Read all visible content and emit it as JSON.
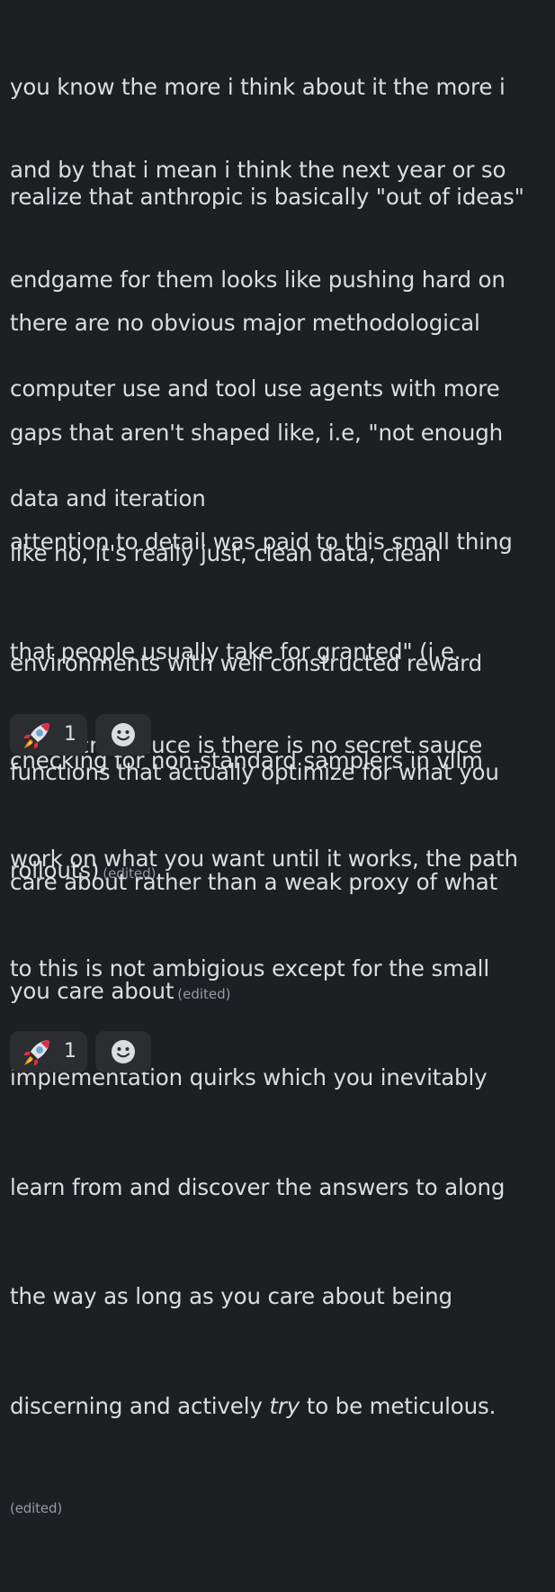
{
  "messages": [
    {
      "lines": [
        "you know the more i think about it the more i",
        "realize that anthropic is basically \"out of ideas\""
      ]
    },
    {
      "lines": [
        "and by that i mean i think the next year or so",
        "endgame for them looks like pushing hard on",
        "computer use and tool use agents with more",
        "data and iteration"
      ]
    },
    {
      "lines": [
        "there are no obvious major methodological",
        "gaps that aren't shaped like, i.e, \"not enough",
        "attention to detail was paid to this small thing",
        "that people usually take for granted\" (i.e.",
        "checking for non-standard samplers in vllm",
        "rollouts)"
      ],
      "edited": "(edited)"
    },
    {
      "lines": [
        "like no, it's really just, clean data, clean",
        "environments with well constructed reward",
        "functions that actually optimize for what you",
        "care about rather than a weak proxy of what",
        "you care about"
      ],
      "edited": "(edited)"
    },
    {
      "lines": [
        "the secret sauce is there is no secret sauce"
      ],
      "reaction": {
        "emoji": "rocket-emoji",
        "count": "1"
      }
    },
    {
      "lines": [
        "work on what you want until it works, the path",
        "to this is not ambigious except for the small",
        "implementation quirks which you inevitably",
        "learn from and discover the answers to along",
        "the way as long as you care about being"
      ],
      "last_line_before": "discerning and actively ",
      "last_line_italic": "try",
      "last_line_after": " to be meticulous.",
      "edited": "(edited)",
      "reaction": {
        "emoji": "rocket-emoji",
        "count": "1"
      }
    }
  ],
  "icons": {
    "reaction_emoji": "rocket-icon",
    "add_reaction": "smiley-face-icon"
  },
  "colors": {
    "background": "#1e1f22",
    "text": "#dbdee1",
    "muted": "#949ba4",
    "reaction_bg": "#2b2d31"
  }
}
